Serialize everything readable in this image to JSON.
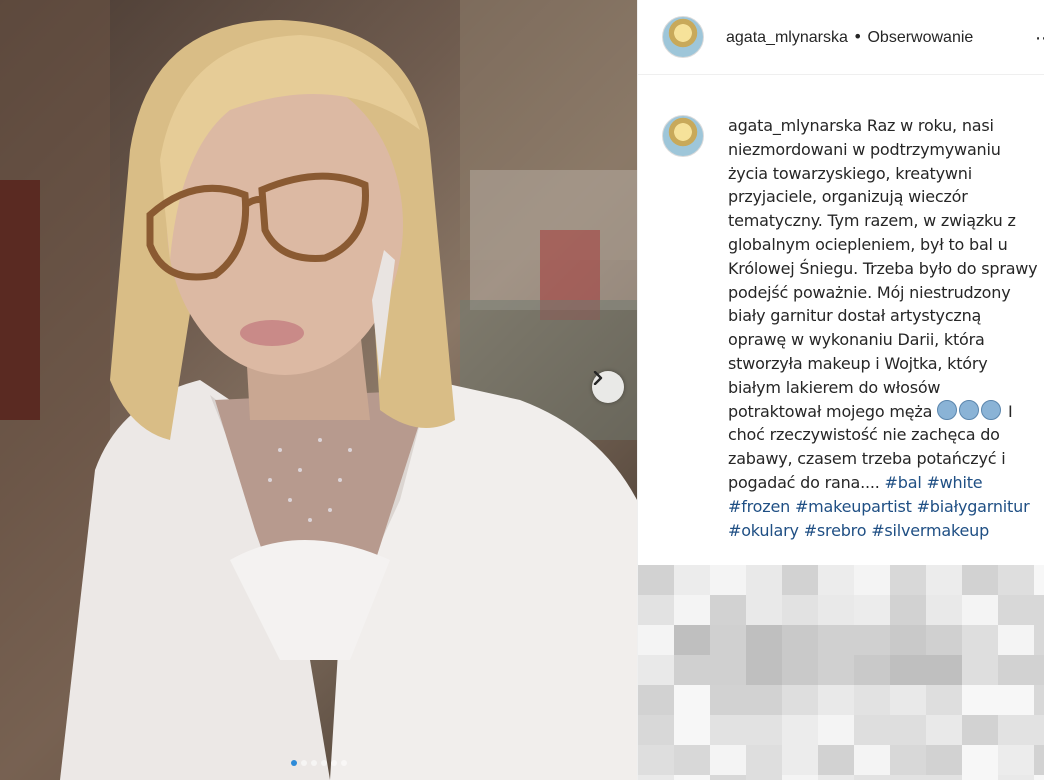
{
  "post": {
    "photo_alt": "Selfie portrait",
    "carousel": {
      "count": 6,
      "active_index": 0
    }
  },
  "header": {
    "username": "agata_mlynarska",
    "separator": "•",
    "follow_label": "Obserwowanie",
    "more_icon": "more-options-icon"
  },
  "caption": {
    "username": "agata_mlynarska",
    "text": "Raz w roku, nasi niezmordowani w podtrzymywaniu życia towarzyskiego, kreatywni przyjaciele, organizują wieczór tematyczny. Tym razem, w związku z globalnym ociepleniem, był to bal u Królowej Śniegu. Trzeba było do sprawy podejść poważnie. Mój niestrudzony biały garnitur dostał artystyczną oprawę w wykonaniu Darii, która stworzyła makeup i Wojtka, który białym lakierem do włosów potraktował mojego męża",
    "emoji_name": "cold-face-emoji",
    "text_after": "I choć rzeczywistość nie zachęca do zabawy, czasem trzeba potańczyć i pogadać do rana....",
    "hashtags": [
      "#bal",
      "#white",
      "#frozen",
      "#makeupartist",
      "#białygarnitur",
      "#okulary",
      "#srebro",
      "#silvermakeup"
    ]
  },
  "colors": {
    "hashtag": "#1f4f84",
    "active_dot": "#2e8bd8"
  }
}
